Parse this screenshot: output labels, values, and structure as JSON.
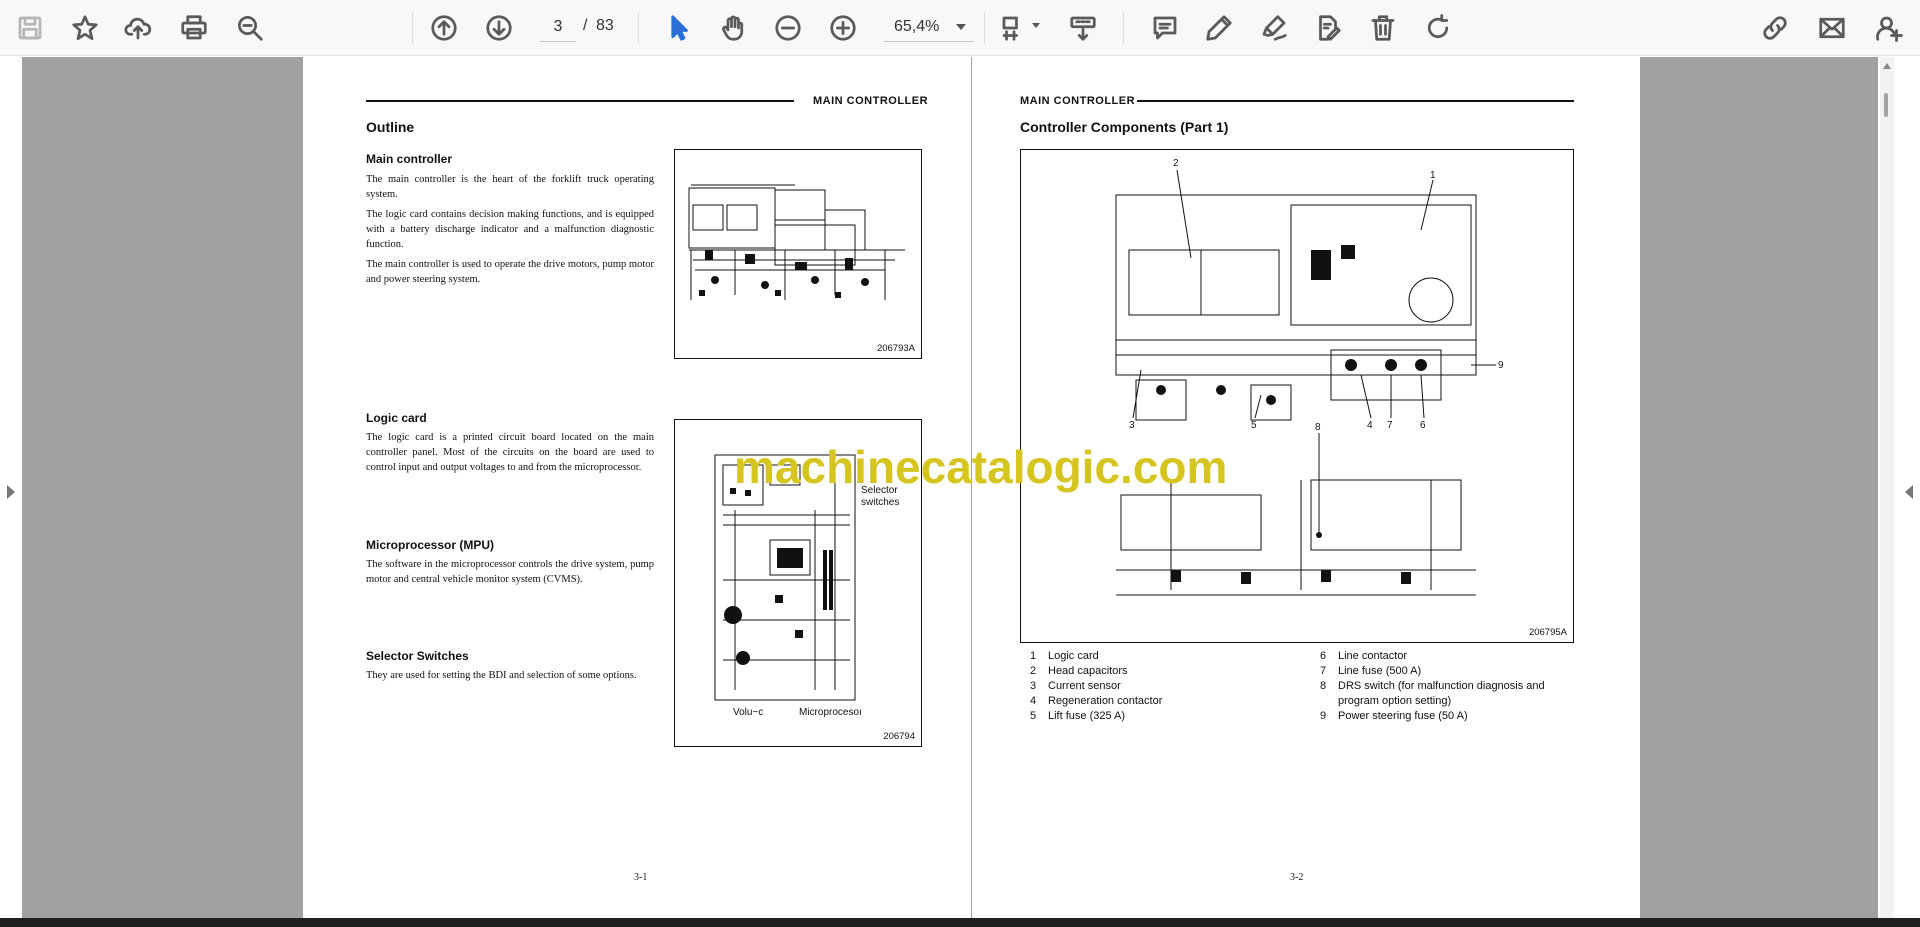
{
  "toolbar": {
    "page_current": "3",
    "page_separator": "/",
    "page_total": "83",
    "zoom": "65,4%",
    "icons": [
      "save-icon",
      "star-icon",
      "upload-icon",
      "print-icon",
      "zoom-out-search-icon",
      "page-up-icon",
      "page-down-icon",
      "pointer-icon",
      "hand-icon",
      "zoom-minus-icon",
      "zoom-plus-icon",
      "page-view-icon",
      "scroll-mode-icon",
      "comment-icon",
      "pen-icon",
      "highlighter-icon",
      "stamp-icon",
      "trash-icon",
      "redo-icon",
      "link-icon",
      "mail-icon",
      "account-icon"
    ]
  },
  "left_page": {
    "header": "MAIN CONTROLLER",
    "title": "Outline",
    "sections": [
      {
        "heading": "Main controller",
        "paragraphs": [
          "The main controller is the heart of the forklift truck operating system.",
          "The logic card contains decision making functions, and is equipped with a battery discharge indicator and a malfunction diagnostic function.",
          "The main controller is used to operate the drive motors, pump motor and power steering system."
        ]
      },
      {
        "heading": "Logic card",
        "paragraphs": [
          "The logic card is a printed circuit board located on the main controller panel.  Most of the circuits on the board are used to control input and output voltages to and from the microprocessor."
        ]
      },
      {
        "heading": "Microprocessor (MPU)",
        "paragraphs": [
          "The software in the microprocessor controls the drive system, pump motor and central vehicle monitor system (CVMS)."
        ]
      },
      {
        "heading": "Selector Switches",
        "paragraphs": [
          "They are used for setting the BDI and selection of some options."
        ]
      }
    ],
    "figure1_id": "206793A",
    "figure2_id": "206794",
    "figure2_labels": {
      "selector": "Selector\nswitches",
      "volume": "Volu~c",
      "micro": "Microprocesoı"
    },
    "footer": "3-1"
  },
  "right_page": {
    "header": "MAIN CONTROLLER",
    "title": "Controller Components (Part 1)",
    "figure_id": "206795A",
    "callouts": [
      "1",
      "2",
      "3",
      "4",
      "5",
      "6",
      "7",
      "8",
      "9"
    ],
    "legend_left": [
      {
        "n": "1",
        "label": "Logic card"
      },
      {
        "n": "2",
        "label": "Head capacitors"
      },
      {
        "n": "3",
        "label": "Current sensor"
      },
      {
        "n": "4",
        "label": "Regeneration contactor"
      },
      {
        "n": "5",
        "label": "Lift fuse (325 A)"
      }
    ],
    "legend_right": [
      {
        "n": "6",
        "label": "Line contactor"
      },
      {
        "n": "7",
        "label": "Line fuse (500 A)"
      },
      {
        "n": "8",
        "label": "DRS switch (for malfunction diagnosis and program option setting)"
      },
      {
        "n": "9",
        "label": "Power steering fuse (50 A)"
      }
    ],
    "footer": "3-2"
  },
  "watermark": "machinecatalogic.com"
}
